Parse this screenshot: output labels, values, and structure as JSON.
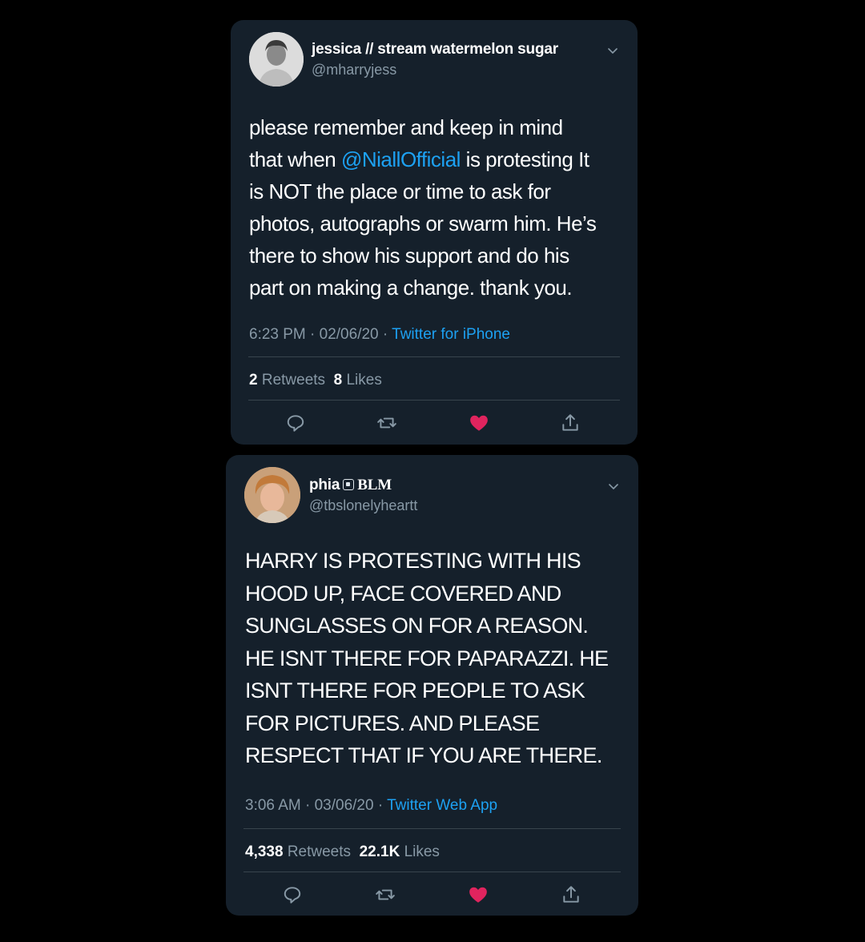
{
  "tweets": [
    {
      "display_name": "jessica // stream watermelon sugar",
      "handle": "@mharryjess",
      "text_lines": [
        [
          "please remember and keep in mind"
        ],
        [
          "that when ",
          "@NiallOfficial",
          " is protesting It"
        ],
        [
          "is NOT the place or time to ask for"
        ],
        [
          "photos, autographs or swarm him. He’s"
        ],
        [
          "there to show his support and do his"
        ],
        [
          "part on making a change. thank you."
        ]
      ],
      "timestamp": "6:23 PM · 02/06/20 · ",
      "source": "Twitter for iPhone",
      "retweets": "2",
      "retweets_label": "Retweets",
      "likes": "8",
      "likes_label": "Likes"
    },
    {
      "display_name": "phia",
      "name_suffix": "BLM",
      "handle": "@tbslonelyheartt",
      "text_lines": [
        "HARRY IS PROTESTING WITH HIS",
        "HOOD UP, FACE COVERED AND",
        "SUNGLASSES ON FOR A REASON.",
        "HE ISNT THERE FOR PAPARAZZI. HE",
        "ISNT THERE FOR PEOPLE TO ASK",
        "FOR PICTURES. AND PLEASE",
        "RESPECT THAT IF YOU ARE THERE."
      ],
      "timestamp": "3:06 AM · 03/06/20 · ",
      "source": "Twitter Web App",
      "retweets": "4,338",
      "retweets_label": "Retweets",
      "likes": "22.1K",
      "likes_label": "Likes"
    }
  ],
  "icons": {
    "reply": "reply-icon",
    "retweet": "retweet-icon",
    "like": "heart-icon",
    "share": "share-icon",
    "menu": "chevron-down-icon",
    "flag": "flag-icon"
  },
  "colors": {
    "background": "#000000",
    "card": "#15202b",
    "link": "#1da1f2",
    "secondary_text": "#8899a6",
    "divider": "#38444d",
    "like_active": "#e0245e"
  }
}
